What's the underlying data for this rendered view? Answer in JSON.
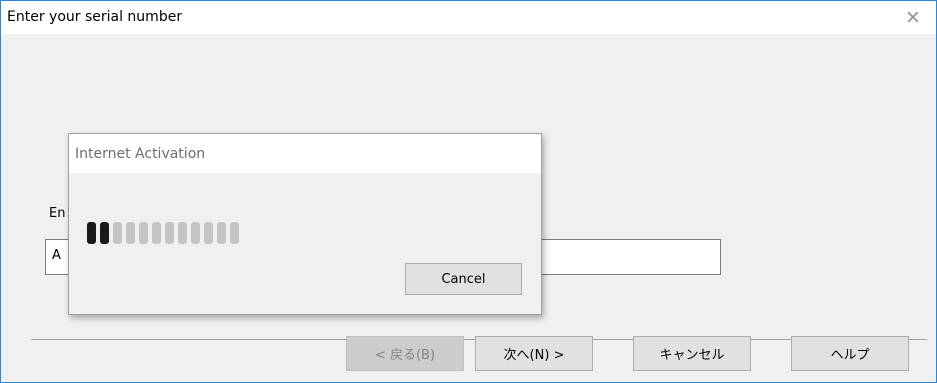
{
  "window": {
    "title": "Enter your serial number",
    "close_glyph": "✕"
  },
  "main": {
    "serial_label_visible": "En",
    "serial_input_value_visible": "A"
  },
  "buttons": {
    "back": "< 戻る(B)",
    "next": "次へ(N) >",
    "cancel": "キャンセル",
    "help": "ヘルプ"
  },
  "activation_dialog": {
    "title": "Internet Activation",
    "cancel_label": "Cancel",
    "progress": {
      "segments_total": 12,
      "segments_active": 2
    }
  },
  "icons": {
    "close": "close-icon"
  },
  "colors": {
    "window_border": "#2b88d8",
    "progress_active": "#1a1a1a",
    "progress_inactive": "#c4c4c4"
  }
}
